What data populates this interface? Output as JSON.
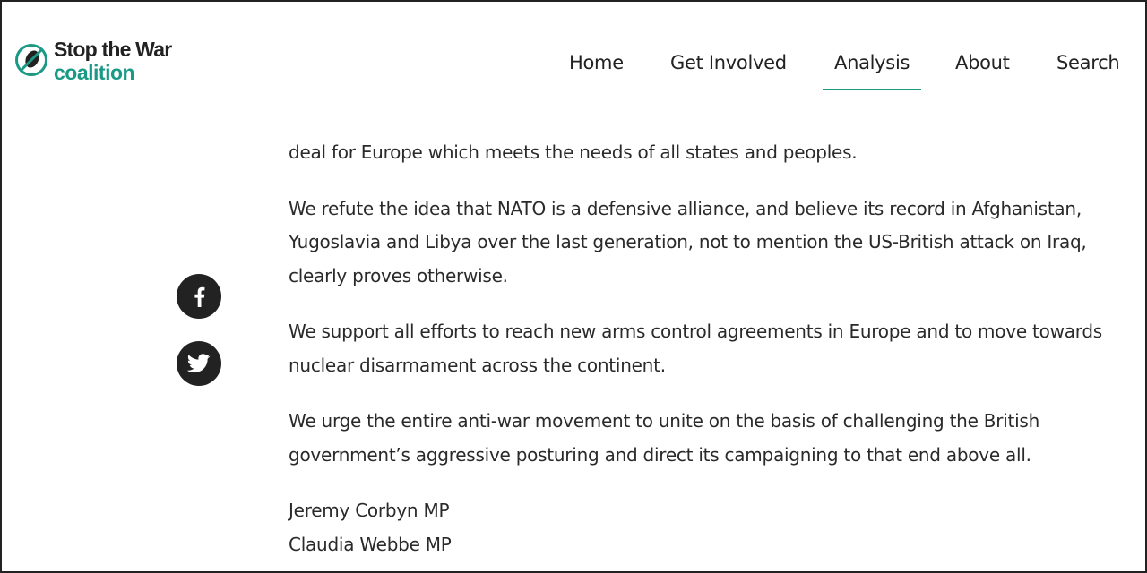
{
  "brand": {
    "line1": "Stop the War",
    "line2": "coalition",
    "accent_color": "#1a9a86",
    "icon": "dove-bomb-logo-icon"
  },
  "nav": {
    "items": [
      {
        "label": "Home"
      },
      {
        "label": "Get Involved"
      },
      {
        "label": "Analysis",
        "active": true
      },
      {
        "label": "About"
      },
      {
        "label": "Search"
      }
    ]
  },
  "share": {
    "facebook_icon": "facebook-icon",
    "twitter_icon": "twitter-icon"
  },
  "article": {
    "lines": [
      "deal for Europe which meets the needs of all states and peoples.",
      "We refute the idea that NATO is a defensive alliance, and believe its record in Afghanistan,",
      "Yugoslavia and Libya over the last generation, not to mention the US-British attack on Iraq,",
      "clearly proves otherwise.",
      "We support all efforts to reach new arms control agreements in Europe and to move towards",
      "nuclear disarmament across the continent.",
      "We urge the entire anti-war movement to unite on the basis of challenging the British",
      "government’s aggressive posturing and direct its campaigning to that end above all."
    ],
    "signatories": [
      "Jeremy Corbyn MP",
      "Claudia Webbe MP"
    ]
  }
}
